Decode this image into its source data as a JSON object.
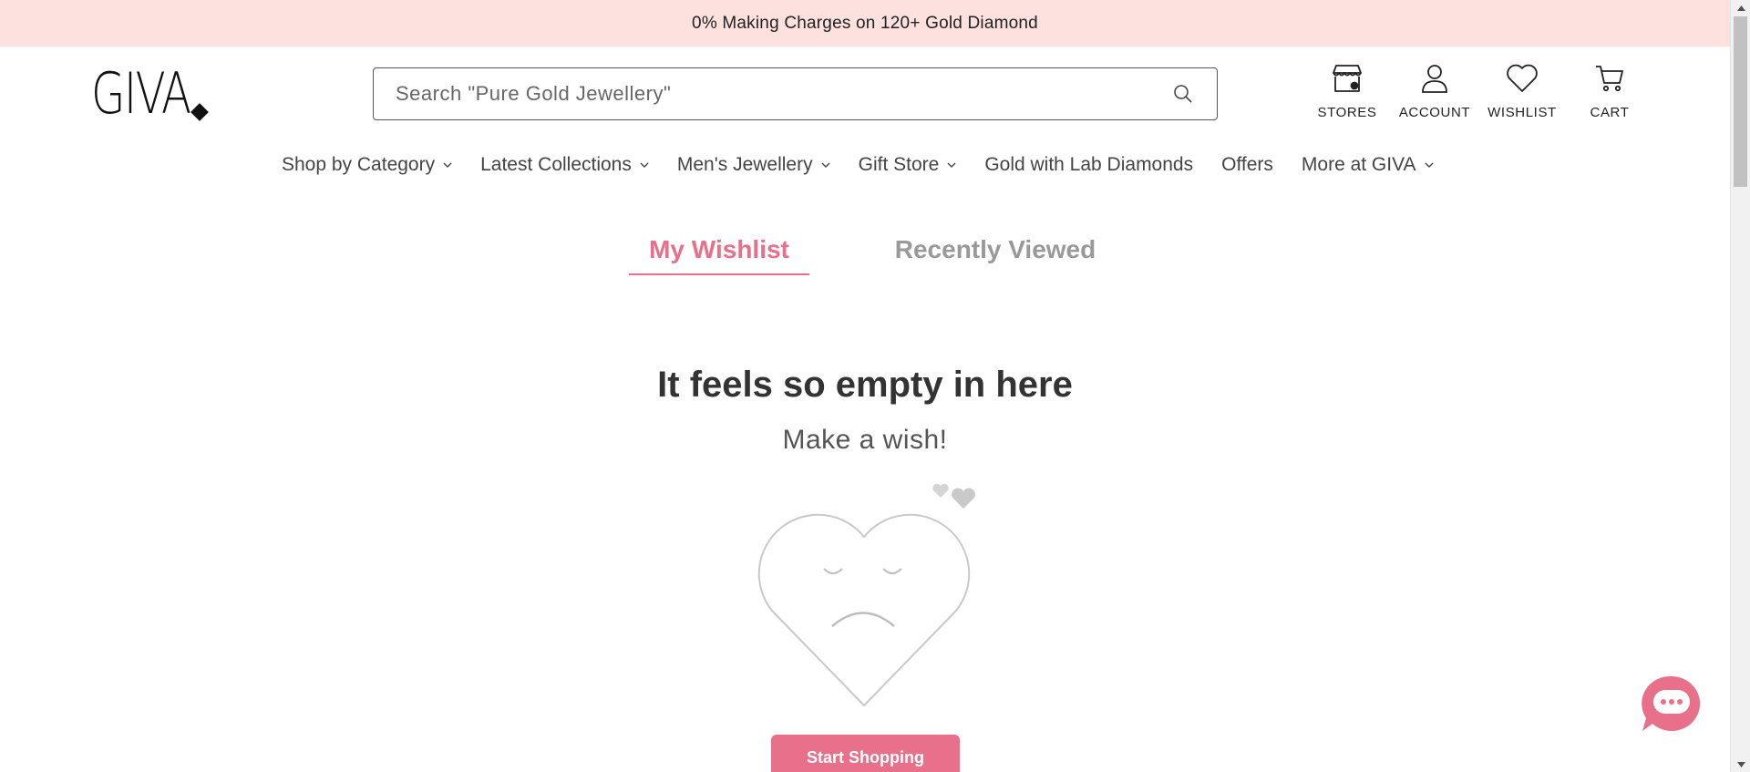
{
  "announcement": "0% Making Charges on 120+ Gold Diamond",
  "brand": {
    "logo_text": "GIVA",
    "accent_color": "#e9708a",
    "banner_color": "#fde1df"
  },
  "search": {
    "placeholder": "Search \"Pure Gold Jewellery\"",
    "icon": "search-icon"
  },
  "header_icons": [
    {
      "label": "STORES",
      "icon": "store-icon"
    },
    {
      "label": "ACCOUNT",
      "icon": "user-icon"
    },
    {
      "label": "WISHLIST",
      "icon": "heart-icon"
    },
    {
      "label": "CART",
      "icon": "cart-icon"
    }
  ],
  "nav": [
    {
      "label": "Shop by Category",
      "has_dropdown": true
    },
    {
      "label": "Latest Collections",
      "has_dropdown": true
    },
    {
      "label": "Men's Jewellery",
      "has_dropdown": true
    },
    {
      "label": "Gift Store",
      "has_dropdown": true
    },
    {
      "label": "Gold with Lab Diamonds",
      "has_dropdown": false
    },
    {
      "label": "Offers",
      "has_dropdown": false
    },
    {
      "label": "More at GIVA",
      "has_dropdown": true
    }
  ],
  "tabs": [
    {
      "label": "My Wishlist",
      "active": true
    },
    {
      "label": "Recently Viewed",
      "active": false
    }
  ],
  "empty_state": {
    "title": "It feels so empty in here",
    "subtitle": "Make a wish!",
    "button_label": "Start Shopping"
  }
}
